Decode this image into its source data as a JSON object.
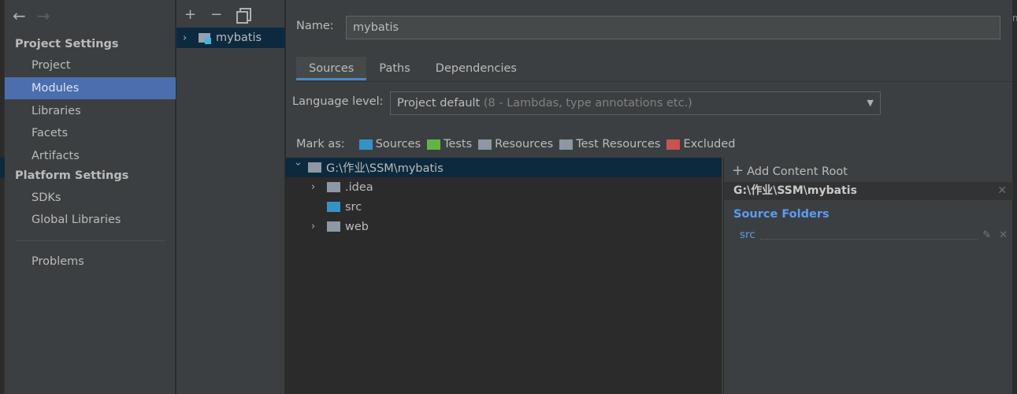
{
  "window": {
    "edge_glyph": "m"
  },
  "nav": {
    "back_icon": "←",
    "forward_icon": "→"
  },
  "sidebar": {
    "section_project": "Project Settings",
    "items_project": [
      "Project",
      "Modules",
      "Libraries",
      "Facets",
      "Artifacts"
    ],
    "active_item": "Modules",
    "section_platform": "Platform Settings",
    "items_platform": [
      "SDKs",
      "Global Libraries"
    ],
    "problems": "Problems"
  },
  "modules": {
    "toolbar": {
      "add_icon": "+",
      "remove_icon": "−",
      "copy_icon": "copy-icon"
    },
    "items": [
      {
        "label": "mybatis",
        "expand_icon": "›"
      }
    ]
  },
  "main": {
    "name_label": "Name:",
    "name_value": "mybatis",
    "tabs": [
      "Sources",
      "Paths",
      "Dependencies"
    ],
    "active_tab": "Sources",
    "language_level_label": "Language level:",
    "language_level_value": "Project default",
    "language_level_hint": "(8 - Lambdas, type annotations etc.)",
    "dropdown_icon": "▼",
    "mark_as_label": "Mark as:",
    "mark_as": [
      {
        "label": "Sources",
        "color": "#3592c4"
      },
      {
        "label": "Tests",
        "color": "#62b543"
      },
      {
        "label": "Resources",
        "color": "#8d98a4"
      },
      {
        "label": "Test Resources",
        "color": "#8d98a4"
      },
      {
        "label": "Excluded",
        "color": "#c75450"
      }
    ],
    "tree": {
      "root": "G:\\作业\\SSM\\mybatis",
      "children": [
        {
          "label": ".idea",
          "expandable": "›",
          "color": "#8d98a4"
        },
        {
          "label": "src",
          "expandable": "",
          "color": "#3592c4"
        },
        {
          "label": "web",
          "expandable": "›",
          "color": "#8d98a4"
        }
      ]
    },
    "content_root": {
      "add_label": "Add Content Root",
      "path": "G:\\作业\\SSM\\mybatis",
      "source_folders_title": "Source Folders",
      "source_folders": [
        "src"
      ]
    }
  },
  "colors": {
    "accent": "#4b6eaf",
    "selection": "#0d293e",
    "link": "#589df6"
  }
}
